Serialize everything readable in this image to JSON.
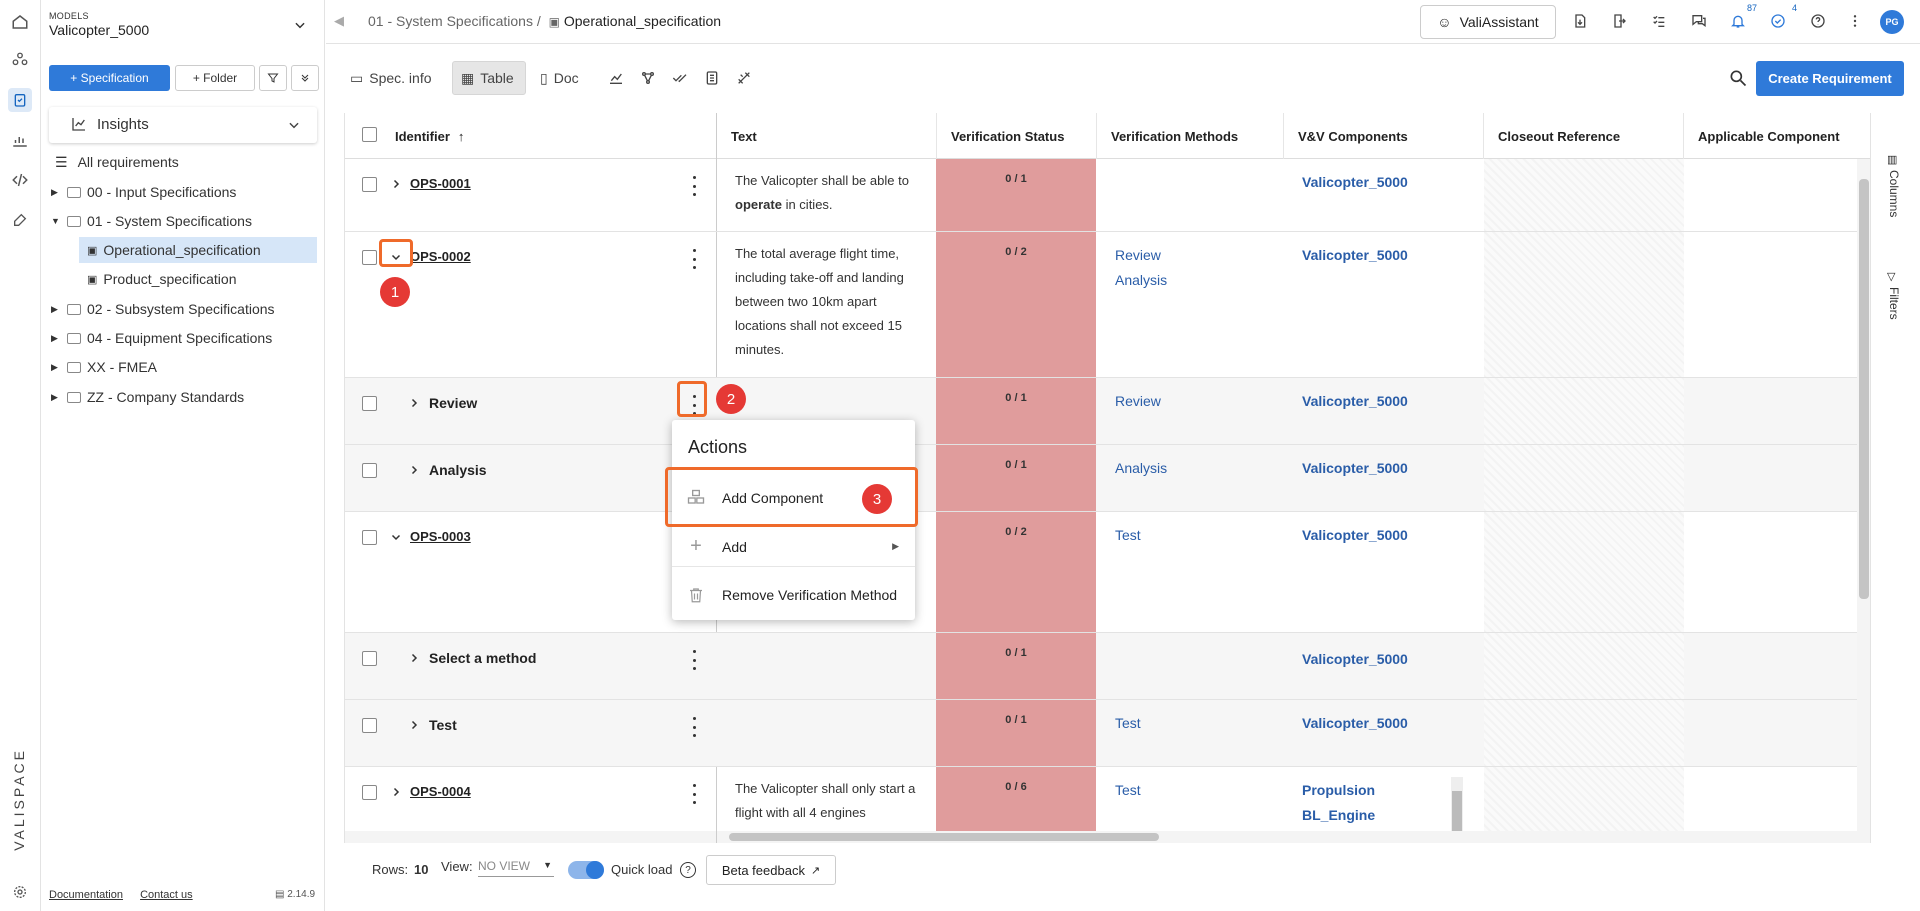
{
  "models": {
    "label": "MODELS",
    "name": "Valicopter_5000"
  },
  "tree_buttons": {
    "specification": "Specification",
    "folder": "Folder"
  },
  "insights": "Insights",
  "tree": [
    {
      "label": "All requirements"
    },
    {
      "label": "00 - Input Specifications"
    },
    {
      "label": "01 - System Specifications"
    },
    {
      "label": "Operational_specification"
    },
    {
      "label": "Product_specification"
    },
    {
      "label": "02 - Subsystem Specifications"
    },
    {
      "label": "04 - Equipment Specifications"
    },
    {
      "label": "XX - FMEA"
    },
    {
      "label": "ZZ - Company Standards"
    }
  ],
  "footer": {
    "documentation": "Documentation",
    "contact": "Contact us",
    "version": "2.14.9"
  },
  "brand": "VALISPACE",
  "breadcrumb": {
    "parent": "01 - System Specifications /",
    "current": "Operational_specification"
  },
  "topbar": {
    "assistant": "ValiAssistant",
    "notif_count": "87",
    "tasks_count": "4",
    "avatar": "PG"
  },
  "view_tabs": {
    "spec_info": "Spec. info",
    "table": "Table",
    "doc": "Doc"
  },
  "create_requirement": "Create Requirement",
  "columns": {
    "identifier": "Identifier",
    "text": "Text",
    "verification_status": "Verification Status",
    "verification_methods": "Verification Methods",
    "vv_components": "V&V Components",
    "closeout_reference": "Closeout Reference",
    "applicable_component": "Applicable Component"
  },
  "rows": [
    {
      "id": "OPS-0001",
      "text_a": "The Valicopter shall be able to ",
      "text_b": "operate",
      "text_c": " in cities.",
      "status": "0 / 1",
      "methods": "",
      "components": "Valicopter_5000"
    },
    {
      "id": "OPS-0002",
      "text": "The total average flight time, including take-off and landing between two 10km apart locations shall not exceed 15 minutes.",
      "status": "0 / 2",
      "methods": [
        "Review",
        "Analysis"
      ],
      "components": "Valicopter_5000"
    },
    {
      "sub": "Review",
      "status": "0 / 1",
      "methods": "Review",
      "components": "Valicopter_5000"
    },
    {
      "sub": "Analysis",
      "status": "0 / 1",
      "methods": "Analysis",
      "components": "Valicopter_5000"
    },
    {
      "id": "OPS-0003",
      "status": "0 / 2",
      "methods": "Test",
      "components": "Valicopter_5000"
    },
    {
      "sub": "Select a method",
      "status": "0 / 1",
      "methods": "",
      "components": "Valicopter_5000"
    },
    {
      "sub": "Test",
      "status": "0 / 1",
      "methods": "Test",
      "components": "Valicopter_5000"
    },
    {
      "id": "OPS-0004",
      "text": "The Valicopter shall only start a flight with all 4 engines",
      "status": "0 / 6",
      "methods": "Test",
      "components": [
        "Propulsion",
        "BL_Engine"
      ]
    }
  ],
  "menu": {
    "title": "Actions",
    "add_component": "Add Component",
    "add": "Add",
    "remove": "Remove Verification Method"
  },
  "markers": [
    "1",
    "2",
    "3"
  ],
  "bottom": {
    "rows_label": "Rows:",
    "rows_value": "10",
    "view_label": "View:",
    "view_value": "NO VIEW",
    "quick_load": "Quick load",
    "beta": "Beta feedback"
  },
  "side": {
    "columns": "Columns",
    "filters": "Filters"
  }
}
